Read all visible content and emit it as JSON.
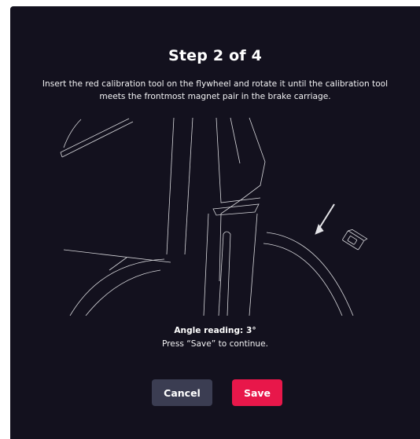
{
  "dialog": {
    "title": "Step 2 of 4",
    "instructions": "Insert the red calibration tool on the flywheel and rotate it until the calibration tool meets the frontmost magnet pair in the brake carriage.",
    "reading": "Angle reading: 3°",
    "hint": "Press “Save” to continue.",
    "cancel_label": "Cancel",
    "save_label": "Save"
  },
  "colors": {
    "background": "#13111e",
    "cancel_button": "#3b3d52",
    "save_button": "#e8174a"
  }
}
